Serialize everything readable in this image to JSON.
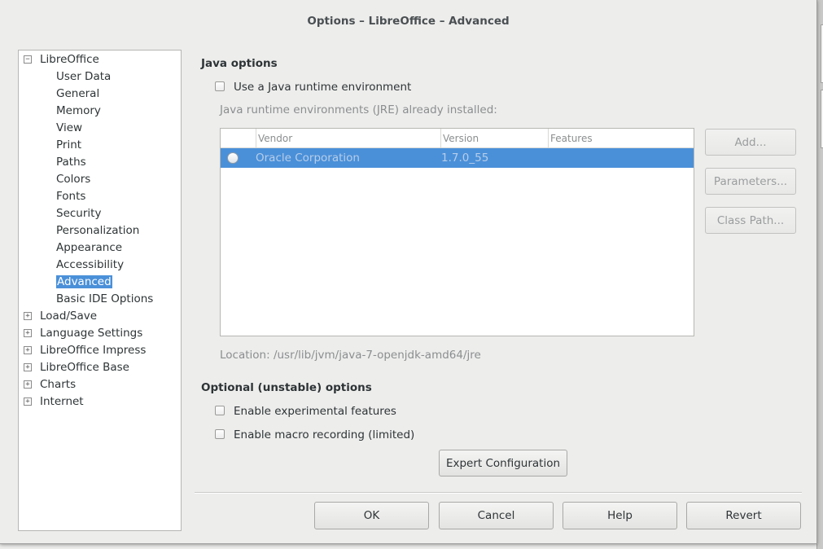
{
  "window": {
    "title": "Options – LibreOffice – Advanced"
  },
  "tree": {
    "root": "LibreOffice",
    "children": [
      "User Data",
      "General",
      "Memory",
      "View",
      "Print",
      "Paths",
      "Colors",
      "Fonts",
      "Security",
      "Personalization",
      "Appearance",
      "Accessibility",
      "Advanced",
      "Basic IDE Options"
    ],
    "selected": "Advanced",
    "collapsed_groups": [
      "Load/Save",
      "Language Settings",
      "LibreOffice Impress",
      "LibreOffice Base",
      "Charts",
      "Internet"
    ]
  },
  "java": {
    "section_title": "Java options",
    "use_jre_label": "Use a Java runtime environment",
    "use_jre_checked": false,
    "installed_label": "Java runtime environments (JRE) already installed:",
    "table": {
      "headers": [
        "Vendor",
        "Version",
        "Features"
      ],
      "rows": [
        {
          "vendor": "Oracle Corporation",
          "version": "1.7.0_55",
          "features": "",
          "selected": true
        }
      ]
    },
    "buttons": {
      "add": "Add...",
      "parameters": "Parameters...",
      "class_path": "Class Path..."
    },
    "location": "Location: /usr/lib/jvm/java-7-openjdk-amd64/jre"
  },
  "optional": {
    "section_title": "Optional (unstable) options",
    "experimental_label": "Enable experimental features",
    "experimental_checked": false,
    "macro_label": "Enable macro recording (limited)",
    "macro_checked": false,
    "expert_button": "Expert Configuration"
  },
  "footer": {
    "ok": "OK",
    "cancel": "Cancel",
    "help": "Help",
    "revert": "Revert"
  },
  "colors": {
    "selection": "#4a90d9",
    "window_bg": "#ededec",
    "disabled_text": "#8b8e8f"
  }
}
